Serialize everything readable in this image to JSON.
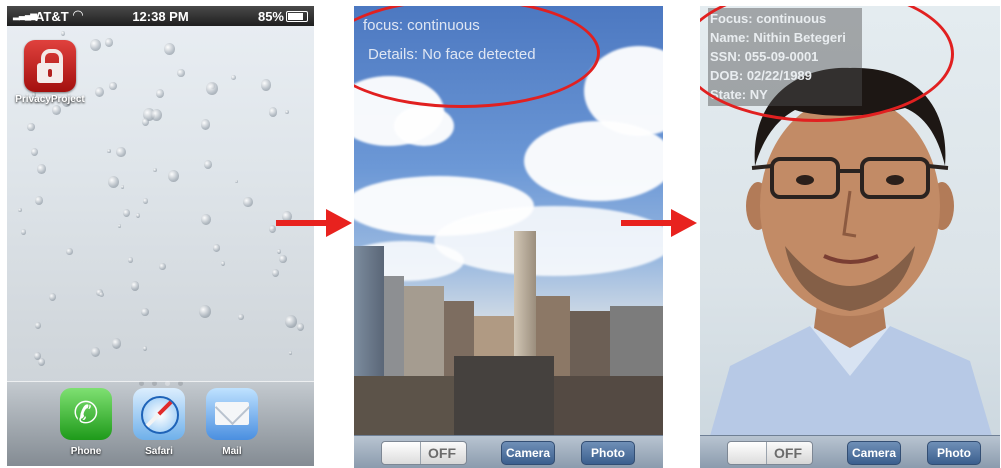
{
  "home_screen": {
    "status_bar": {
      "carrier": "AT&T",
      "time": "12:38 PM",
      "battery": "85%"
    },
    "apps": [
      {
        "label": "PrivacyProject",
        "icon": "lock-icon"
      }
    ],
    "dock": [
      {
        "label": "Phone",
        "icon": "phone-icon"
      },
      {
        "label": "Safari",
        "icon": "compass-icon"
      },
      {
        "label": "Mail",
        "icon": "envelope-icon"
      }
    ],
    "pages": 4,
    "current_page": 3
  },
  "sky_view": {
    "focus": "focus: continuous",
    "details": "Details: No face detected"
  },
  "face_view": {
    "lines": [
      "Focus: continuous",
      "Name: Nithin Betegeri",
      "SSN: 055-09-0001",
      "DOB: 02/22/1989",
      "State: NY"
    ]
  },
  "toolbar": {
    "toggle_state": "OFF",
    "camera_label": "Camera",
    "photo_label": "Photo"
  },
  "colors": {
    "highlight": "#e12020",
    "arrow": "#e8221e",
    "toolbar_button": "#3b5f8e"
  }
}
